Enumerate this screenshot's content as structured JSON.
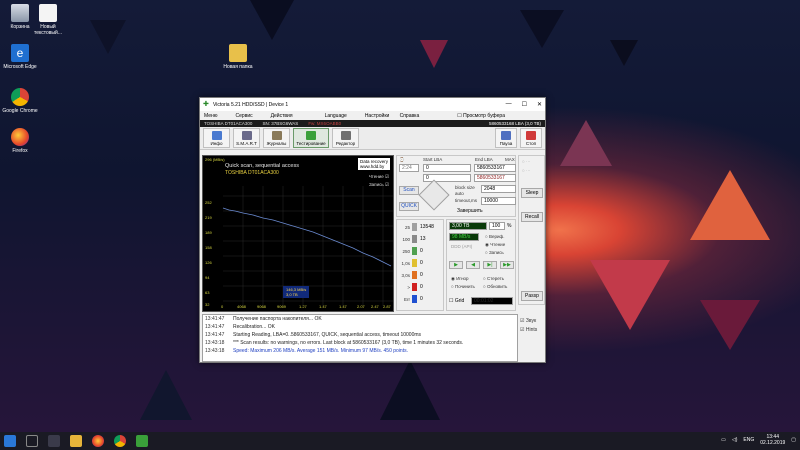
{
  "desktop": {
    "icons": [
      {
        "label": "Корзина"
      },
      {
        "label": "Новый текстовый..."
      },
      {
        "label": "Microsoft Edge"
      },
      {
        "label": "Google Chrome"
      },
      {
        "label": "Firefox"
      },
      {
        "label": "Новая папка"
      }
    ]
  },
  "window": {
    "title": "Victoria 5.21 HDD/SSD | Device 1",
    "controls": {
      "minimize": "—",
      "maximize": "☐",
      "close": "✕"
    },
    "menu": [
      "Меню",
      "Сервис",
      "Действия",
      "Language",
      "Настройки"
    ],
    "menu_right": {
      "help": "Справка",
      "buffer": "Просмотр буфера"
    },
    "info": {
      "model": "TOSHIBA DT01ACA300",
      "serial": "SN: 37BSG6WAS",
      "firmware": "Fw: MX6OABB0",
      "lba": "5860533168 LBA (3,0 TB)"
    },
    "toolbar": [
      {
        "label": "Инфо",
        "icon": "info-icon"
      },
      {
        "label": "S.M.A.R.T",
        "icon": "smart-icon"
      },
      {
        "label": "Журналы",
        "icon": "logs-icon"
      },
      {
        "label": "Тестирование",
        "icon": "test-icon"
      },
      {
        "label": "Редактор",
        "icon": "editor-icon"
      }
    ],
    "toolbar_right": {
      "pause": "Пауза",
      "stop": "Стоп"
    },
    "graph": {
      "corner": "296 (MB/s)",
      "title": "Quick scan, sequential access",
      "model": "TOSHIBA DT01ACA300",
      "data_recovery": "Data recovery",
      "site": "www.hdd.by",
      "read_chk": "Чтение",
      "write_chk": "Запись",
      "y_ticks": [
        "252",
        "219",
        "189",
        "158",
        "126",
        "94",
        "63",
        "32"
      ],
      "x_ticks": [
        "0",
        "4068",
        "9068",
        "9069",
        "1.27",
        "1.47",
        "1.47",
        "2.07",
        "2.47",
        "2.87"
      ],
      "speed_line1": "146,3 MB/s",
      "speed_line2": "3,0 TB"
    },
    "lba": {
      "start_label": "Start LBA",
      "end_label": "End LBA",
      "max_label": "MAX",
      "start_value": "0",
      "end_value": "5860533167",
      "cur_label": "0",
      "end_value2": "5860533167",
      "time_value": "2:24",
      "block_size_label": "block size",
      "block_size": "2048",
      "timeout_label": "timeout,ms",
      "timeout": "10000",
      "auto_label": "auto",
      "complete": "Завершить"
    },
    "scan": {
      "scan": "Scan",
      "quick": "QUICK"
    },
    "progress": {
      "done": "3,00 TB",
      "percent": "100",
      "percent_unit": "%",
      "speed": "98 MB/s"
    },
    "blocks": [
      {
        "label": "25",
        "count": "13548",
        "color": "#a0a0a0"
      },
      {
        "label": "100",
        "count": "13",
        "color": "#8a8a8a"
      },
      {
        "label": "250",
        "count": "0",
        "color": "#50a050"
      },
      {
        "label": "1,0s",
        "count": "0",
        "color": "#e0c030"
      },
      {
        "label": "3,0s",
        "count": "0",
        "color": "#e07020"
      },
      {
        "label": ">",
        "count": "0",
        "color": "#d02020"
      },
      {
        "label": "Err",
        "count": "0",
        "color": "#2050d0"
      }
    ],
    "modes": {
      "verify": "Вериф.",
      "read": "Чтение",
      "write": "Запись"
    },
    "ddd": "DDD (API)",
    "actions": {
      "ignore": "Игнор",
      "erase": "Стереть",
      "remap": "Починить",
      "refresh": "Обновить"
    },
    "grid": {
      "label": "Grid",
      "value": "00:01:02"
    },
    "side_buttons": {
      "sleep": "Sleep",
      "recall": "Recall",
      "passp": "Passp"
    },
    "checks": {
      "sound": "Звук",
      "hints": "Hints"
    },
    "log": [
      {
        "time": "13:41:47",
        "msg": "Получение паспорта накопителя... OK",
        "speed": false
      },
      {
        "time": "13:41:47",
        "msg": "Recalibration... OK",
        "speed": false
      },
      {
        "time": "13:41:47",
        "msg": "Starting Reading, LBA=0..5860533167, QUICK, sequential access, timeout 10000ms",
        "speed": false
      },
      {
        "time": "13:43:18",
        "msg": "*** Scan results: no warnings, no errors. Last block at 5860533167 (3,0 TB), time 1 minutes 32 seconds.",
        "speed": false
      },
      {
        "time": "13:43:18",
        "msg": "Speed: Maximum 206 MB/s. Average 151 MB/s. Minimum 97 MB/s. 450 points.",
        "speed": true
      }
    ]
  },
  "taskbar": {
    "lang": "ENG",
    "time": "13:44",
    "date": "02.12.2019"
  }
}
